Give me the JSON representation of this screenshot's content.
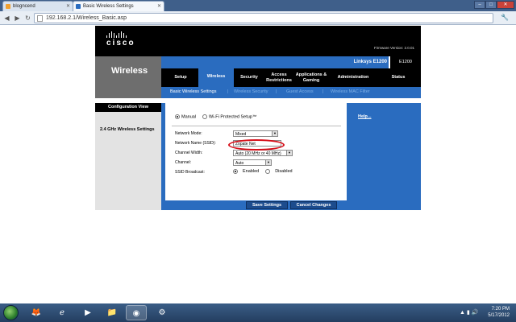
{
  "browser": {
    "tabs": [
      {
        "label": "blogncend",
        "favicon_color": "#f0a030"
      },
      {
        "label": "Basic Wireless Settings",
        "favicon_color": "#2a6cbf"
      }
    ],
    "url": "192.168.2.1/Wireless_Basic.asp",
    "back_icon": "back-arrow-icon",
    "forward_icon": "forward-arrow-icon",
    "reload_icon": "reload-icon"
  },
  "router": {
    "brand": "cisco",
    "firmware": "Firmware Version: 2.0.01",
    "model_name": "Linksys E1200",
    "model_short": "E1200",
    "section_title": "Wireless",
    "main_tabs": [
      {
        "label": "Setup",
        "active": false
      },
      {
        "label": "Wireless",
        "active": true
      },
      {
        "label": "Security",
        "active": false
      },
      {
        "label": "Access Restrictions",
        "active": false
      },
      {
        "label": "Applications & Gaming",
        "active": false
      },
      {
        "label": "Administration",
        "active": false
      },
      {
        "label": "Status",
        "active": false
      }
    ],
    "sub_tabs": [
      {
        "label": "Basic Wireless Settings",
        "active": true
      },
      {
        "label": "Wireless Security",
        "active": false
      },
      {
        "label": "Guest Access",
        "active": false
      },
      {
        "label": "Wireless MAC Filter",
        "active": false
      }
    ],
    "config_view": "Configuration View",
    "section_label": "2.4 GHz Wireless Settings",
    "mode_options": {
      "manual": "Manual",
      "wps": "Wi-Fi Protected Setup™",
      "selected": "manual"
    },
    "fields": {
      "network_mode": {
        "label": "Network Mode:",
        "value": "Mixed"
      },
      "ssid": {
        "label": "Network Name (SSID):",
        "value": "Zopate Net"
      },
      "channel_width": {
        "label": "Channel Width:",
        "value": "Auto (20 MHz or 40 MHz)"
      },
      "channel": {
        "label": "Channel:",
        "value": "Auto"
      },
      "ssid_broadcast": {
        "label": "SSID Broadcast:",
        "enabled": "Enabled",
        "disabled": "Disabled",
        "selected": "enabled"
      }
    },
    "help": "Help...",
    "save": "Save Settings",
    "cancel": "Cancel Changes",
    "colors": {
      "accent": "#2a6cbf",
      "highlight_ring": "#d6101a"
    }
  },
  "taskbar": {
    "time": "7:20 PM",
    "date": "5/17/2012",
    "apps": [
      "firefox-icon",
      "internet-explorer-icon",
      "media-player-icon",
      "file-explorer-icon",
      "chrome-icon",
      "network-tool-icon"
    ]
  }
}
